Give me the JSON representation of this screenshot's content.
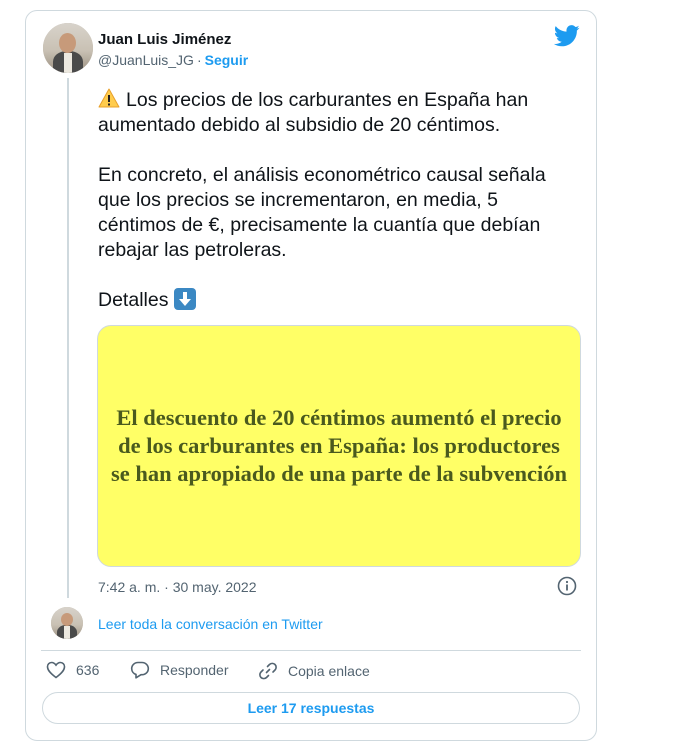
{
  "author": {
    "display_name": "Juan Luis Jiménez",
    "handle": "@JuanLuis_JG",
    "separator": "·",
    "follow_label": "Seguir"
  },
  "tweet": {
    "paragraph1": "Los precios de los carburantes en España han aumentado debido al subsidio de 20 céntimos.",
    "paragraph2": "En concreto, el análisis econométrico causal señala que los precios se incrementaron, en media, 5 céntimos de €, precisamente la cuantía que debían rebajar las petroleras.",
    "paragraph3": "Detalles",
    "icons": [
      "warning-emoji",
      "down-arrow-emoji"
    ]
  },
  "media": {
    "text": "El descuento de 20 céntimos aumentó el precio de los carburantes en España: los productores se han apropiado de una parte de la subvención",
    "background_color": "#ffff66",
    "text_color": "#4a5a1e"
  },
  "timestamp": "7:42 a. m. · 30 may. 2022",
  "conversation_link": "Leer toda la conversación en Twitter",
  "actions": {
    "likes_count": "636",
    "reply_label": "Responder",
    "copy_link_label": "Copia enlace"
  },
  "read_replies_label": "Leer 17 respuestas",
  "colors": {
    "accent": "#1d9bf0",
    "text": "#0f1419",
    "secondary_text": "#536471",
    "border": "#cfd9de"
  }
}
